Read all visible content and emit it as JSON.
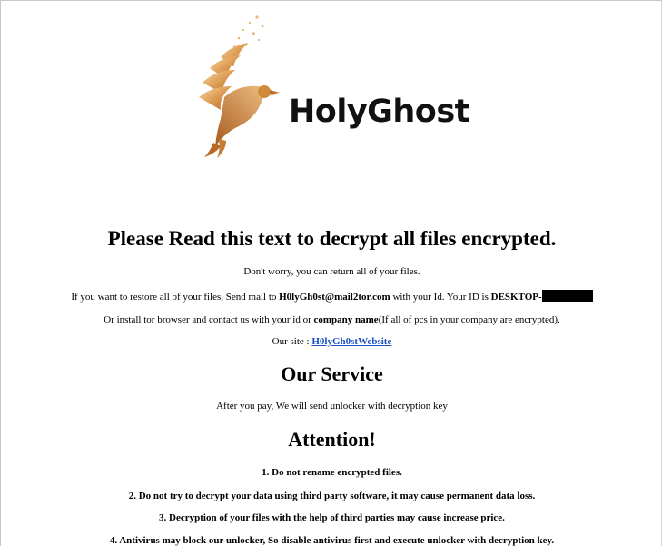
{
  "brand": {
    "name": "HolyGhost"
  },
  "header": {
    "title": "Please Read this text to decrypt all files encrypted."
  },
  "intro": {
    "line1": "Don't worry, you can return all of your files.",
    "line2_prefix": "If you want to restore all of your files, Send mail to ",
    "email": "H0lyGh0st@mail2tor.com",
    "line2_middle": " with your Id. Your ID is ",
    "id_visible": "DESKTOP-",
    "line3_prefix": "Or install tor browser and contact us with your id or ",
    "line3_bold": "company name",
    "line3_suffix": "(If all of pcs in your company are encrypted).",
    "site_label": "Our site : ",
    "site_link": "H0lyGh0stWebsite"
  },
  "service": {
    "title": "Our Service",
    "text": "After you pay, We will send unlocker with decryption key"
  },
  "attention": {
    "title": "Attention!",
    "rules": [
      "1. Do not rename encrypted files.",
      "2. Do not try to decrypt your data using third party software, it may cause permanent data loss.",
      "3. Decryption of your files with the help of third parties may cause increase price.",
      "4. Antivirus may block our unlocker, So disable antivirus first and execute unlocker with decryption key."
    ]
  },
  "colors": {
    "link": "#1a4fc4",
    "logo_gold": "#d99a4a",
    "redaction": "#000000"
  }
}
